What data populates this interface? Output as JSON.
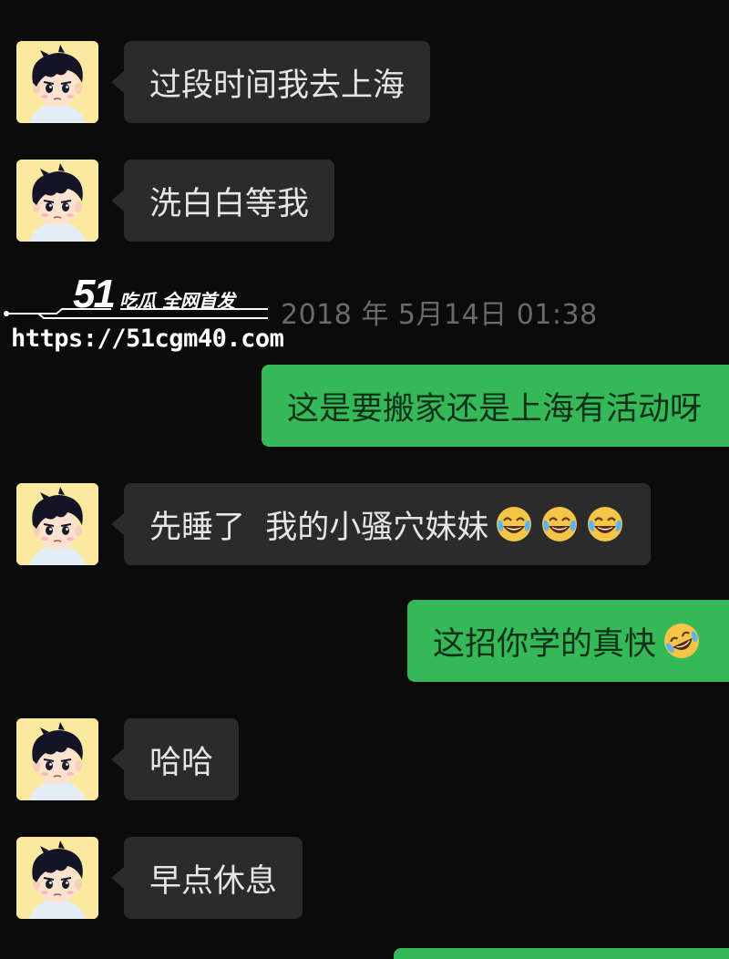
{
  "messages": [
    {
      "side": "in",
      "text": "过段时间我去上海"
    },
    {
      "side": "in",
      "text": "洗白白等我"
    },
    {
      "side": "out",
      "text": "这是要搬家还是上海有活动呀"
    },
    {
      "side": "in",
      "text": "先睡了  我的小骚穴妹妹",
      "emojis": [
        "laugh-cry",
        "laugh-cry",
        "laugh-cry"
      ]
    },
    {
      "side": "out",
      "text": "这招你学的真快",
      "emojis": [
        "laugh-cry-tilted"
      ]
    },
    {
      "side": "in",
      "text": "哈哈"
    },
    {
      "side": "in",
      "text": "早点休息"
    }
  ],
  "timestamp": "2018 年 5月14日 01:38",
  "watermark": {
    "number": "51",
    "tagline": "吃瓜 全网首发",
    "url": "https://51cgm40.com"
  },
  "colors": {
    "background": "#0b0b0b",
    "incoming_bubble": "#2b2b2b",
    "outgoing_bubble": "#35b858",
    "avatar_bg": "#fbe9a0"
  },
  "icons": {
    "avatar": "cartoon-boy-avatar",
    "emoji": "face-with-tears-of-joy"
  }
}
